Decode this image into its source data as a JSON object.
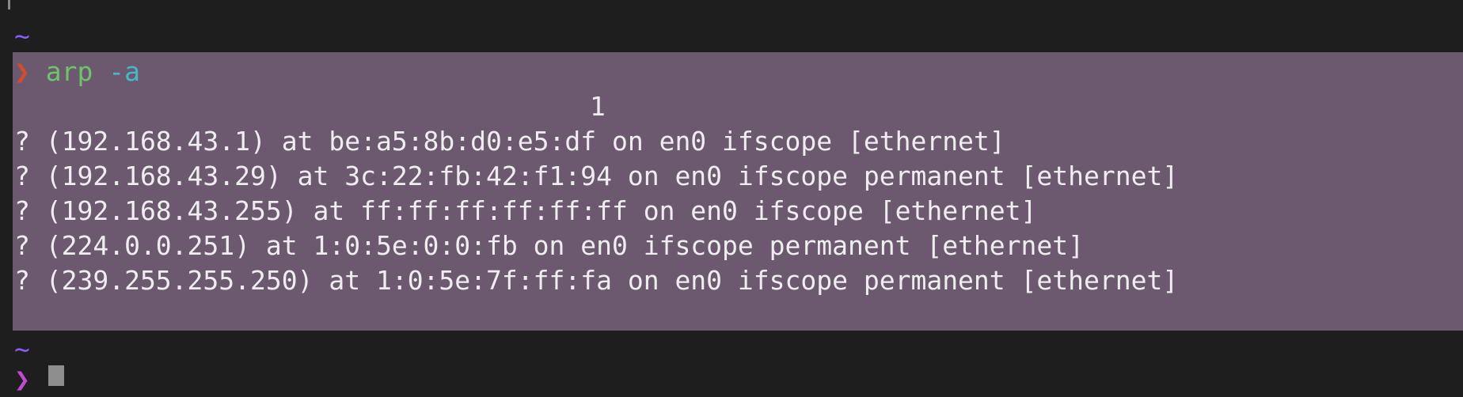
{
  "top_prompt": {
    "tilde": "~"
  },
  "command_block": {
    "prompt_symbol": "❯",
    "command": "arp",
    "argument": "-a",
    "count_line": "1",
    "output_lines": [
      "? (192.168.43.1) at be:a5:8b:d0:e5:df on en0 ifscope [ethernet]",
      "? (192.168.43.29) at 3c:22:fb:42:f1:94 on en0 ifscope permanent [ethernet]",
      "? (192.168.43.255) at ff:ff:ff:ff:ff:ff on en0 ifscope [ethernet]",
      "? (224.0.0.251) at 1:0:5e:0:0:fb on en0 ifscope permanent [ethernet]",
      "? (239.255.255.250) at 1:0:5e:7f:ff:fa on en0 ifscope permanent [ethernet]"
    ]
  },
  "bottom_prompt": {
    "tilde": "~",
    "prompt_symbol": "❯"
  },
  "colors": {
    "background": "#1e1e1e",
    "highlight": "#6c5970",
    "tilde": "#8b5cf6",
    "prompt_arrow": "#d14d2e",
    "command": "#6fc36a",
    "argument": "#47b8c9",
    "text": "#eeeeee"
  }
}
